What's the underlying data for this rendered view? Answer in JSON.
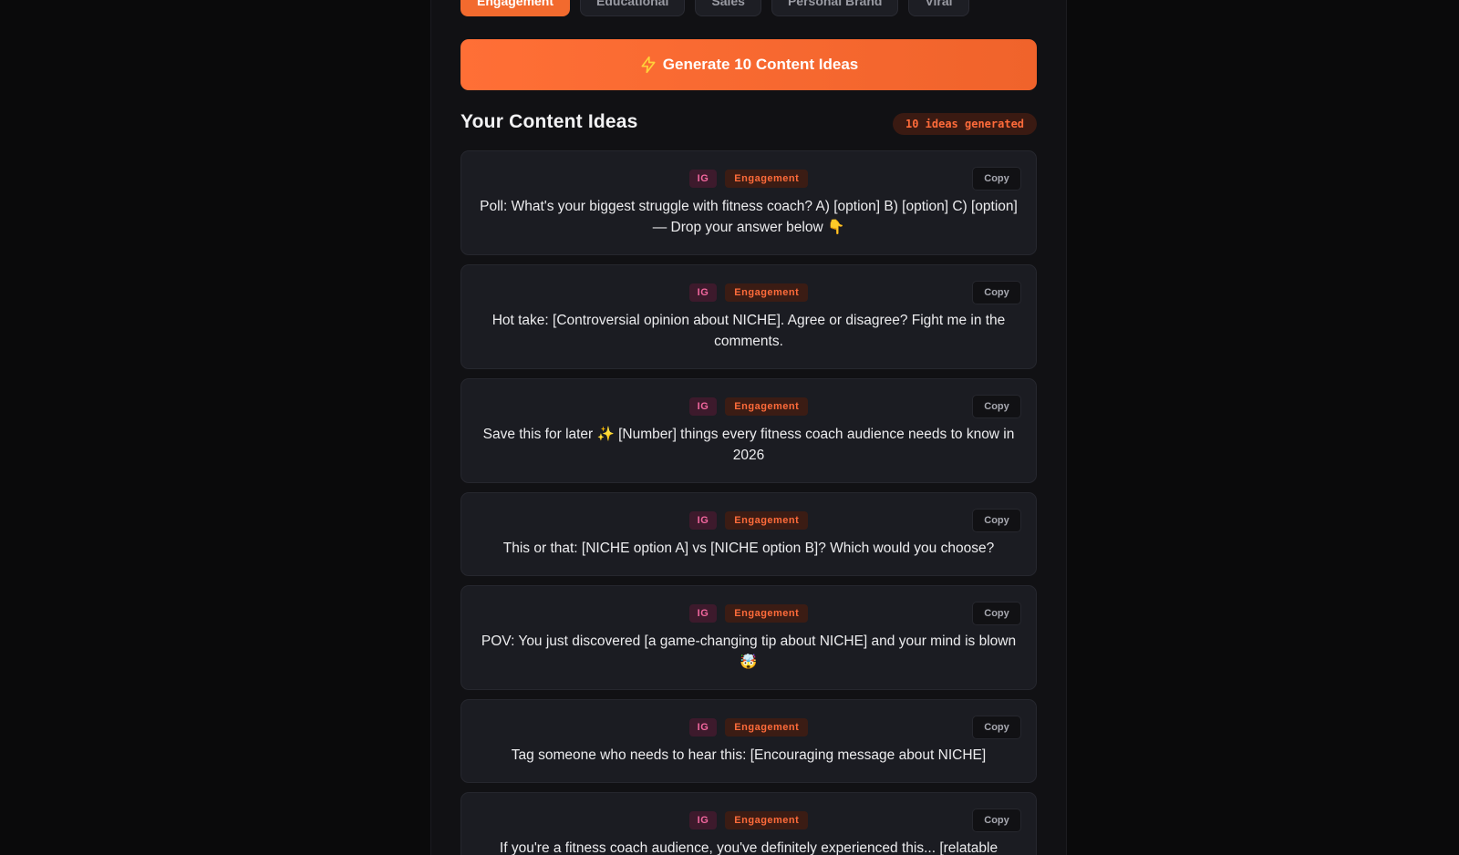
{
  "tabs": [
    {
      "label": "Engagement",
      "active": true
    },
    {
      "label": "Educational",
      "active": false
    },
    {
      "label": "Sales",
      "active": false
    },
    {
      "label": "Personal Brand",
      "active": false
    },
    {
      "label": "Viral",
      "active": false
    }
  ],
  "generate_button": {
    "label": "Generate 10 Content Ideas",
    "icon": "lightning-icon"
  },
  "section_title": "Your Content Ideas",
  "ideas_count": "10 ideas generated",
  "copy_label": "Copy",
  "ideas": [
    {
      "platform": "IG",
      "category": "Engagement",
      "text": "Poll: What's your biggest struggle with fitness coach? A) [option] B) [option] C) [option] — Drop your answer below 👇"
    },
    {
      "platform": "IG",
      "category": "Engagement",
      "text": "Hot take: [Controversial opinion about NICHE]. Agree or disagree? Fight me in the comments."
    },
    {
      "platform": "IG",
      "category": "Engagement",
      "text": "Save this for later ✨ [Number] things every fitness coach audience needs to know in 2026"
    },
    {
      "platform": "IG",
      "category": "Engagement",
      "text": "This or that: [NICHE option A] vs [NICHE option B]? Which would you choose?"
    },
    {
      "platform": "IG",
      "category": "Engagement",
      "text": "POV: You just discovered [a game-changing tip about NICHE] and your mind is blown 🤯"
    },
    {
      "platform": "IG",
      "category": "Engagement",
      "text": "Tag someone who needs to hear this: [Encouraging message about NICHE]"
    },
    {
      "platform": "IG",
      "category": "Engagement",
      "text": "If you're a fitness coach audience, you've definitely experienced this... [relatable"
    }
  ],
  "colors": {
    "accent": "#f26a2e",
    "ig_tag": "#f2679e",
    "category_tag": "#ff6b3a"
  }
}
